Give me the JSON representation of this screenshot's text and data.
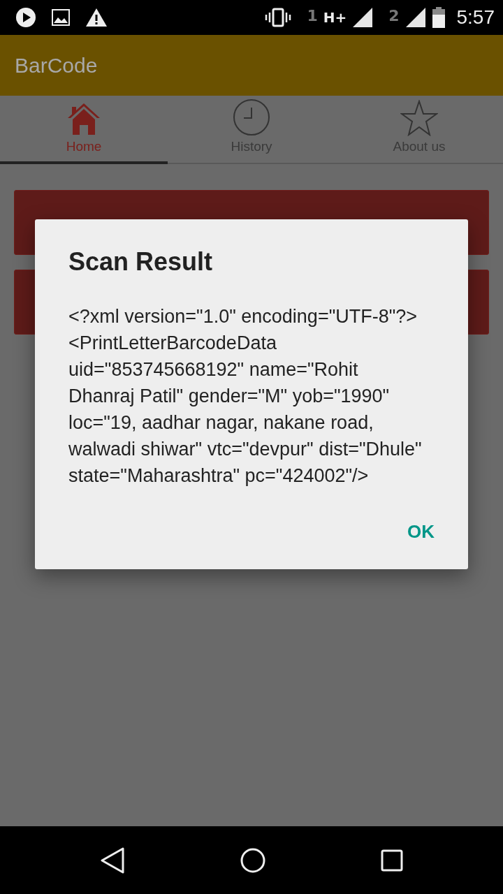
{
  "status_bar": {
    "sim1": "1",
    "network": "H+",
    "sim2": "2",
    "time": "5:57"
  },
  "app_bar": {
    "title": "BarCode"
  },
  "tabs": [
    {
      "label": "Home",
      "kind": "home",
      "selected": true
    },
    {
      "label": "History",
      "kind": "clock",
      "selected": false
    },
    {
      "label": "About us",
      "kind": "star",
      "selected": false
    }
  ],
  "buttons": [
    {
      "kind": "button"
    },
    {
      "kind": "button"
    }
  ],
  "dialog": {
    "title": "Scan Result",
    "message": "<?xml version=\"1.0\" encoding=\"UTF-8\"?> <PrintLetterBarcodeData uid=\"853745668192\" name=\"Rohit Dhanraj Patil\" gender=\"M\" yob=\"1990\" loc=\"19, aadhar nagar, nakane road, walwadi shiwar\" vtc=\"devpur\" dist=\"Dhule\" state=\"Maharashtra\" pc=\"424002\"/>",
    "action": "OK"
  }
}
